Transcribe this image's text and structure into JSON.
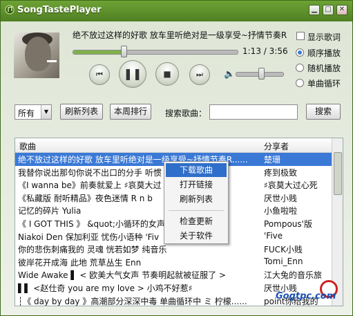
{
  "window": {
    "title": "SongTastePlayer"
  },
  "player": {
    "song_title": "绝不放过这样的好歌 放车里听绝对是一级享受~抒情节奏R",
    "time_current": "1:13",
    "time_sep": "/",
    "time_total": "3:56",
    "progress_fraction": 0.31,
    "volume_fraction": 0.55,
    "show_lyrics_label": "显示歌词",
    "play_modes": [
      "顺序播放",
      "随机播放",
      "单曲循环"
    ],
    "selected_mode_index": 0
  },
  "toolbar": {
    "filter_value": "所有",
    "refresh_label": "刷新列表",
    "weekly_label": "本周排行",
    "search_label": "搜索歌曲：",
    "search_value": "",
    "search_button": "搜索"
  },
  "list": {
    "headers": [
      "歌曲",
      "分享者"
    ],
    "rows": [
      {
        "song": "绝不放过这样的好歌 放车里听绝对是一级享受~抒情节奏R......",
        "sharer": "楚珊"
      },
      {
        "song": "我替你说出那句你说不出口的分手 听惯",
        "sharer": "疼到极致"
      },
      {
        "song": "《I wanna be》前奏就爱上 ♯哀莫大过",
        "sharer": "♯哀莫大过心死"
      },
      {
        "song": "《私藏版 耐听精品》夜色迷情 R n b",
        "sharer": "厌世小贱"
      },
      {
        "song": "记忆的碎片 Yulia",
        "sharer": "小鱼啦啦"
      },
      {
        "song": "《 I GOT THIS 》 &quot;小循环的女声",
        "sharer": "Pompous'版"
      },
      {
        "song": "Niakoi Den 保加利亚 忧伤小语种  'Fiv",
        "sharer": "'Five"
      },
      {
        "song": "你的悲伤刺痛我的 灵魂 恍若如梦 纯音乐",
        "sharer": "FUCK小贱"
      },
      {
        "song": "彼岸花开成海 此地 荒草丛生 Enn",
        "sharer": "Tomi_Enn"
      },
      {
        "song": "Wide Awake ▌ < 欧美大气女声 节奏明起就被征服了 >",
        "sharer": "江大兔的音乐旅"
      },
      {
        "song": "▌▌ <赵仕奇 you are my love > 小鸡不好惹♯",
        "sharer": "厌世小贱"
      },
      {
        "song": "┆《 day by day 》高潮部分深深中毒 单曲循环中 ミ 柠檬......",
        "sharer": "point你给我的"
      }
    ],
    "selected_row_index": 0
  },
  "context_menu": {
    "items": [
      "下载歌曲",
      "打开链接",
      "刷新列表",
      "检查更新",
      "关于软件"
    ],
    "highlighted_index": 0
  },
  "watermark": {
    "text": "Gogtpc.com"
  },
  "colors": {
    "accent": "#3a79d6",
    "title_bar": "#5e9130"
  }
}
